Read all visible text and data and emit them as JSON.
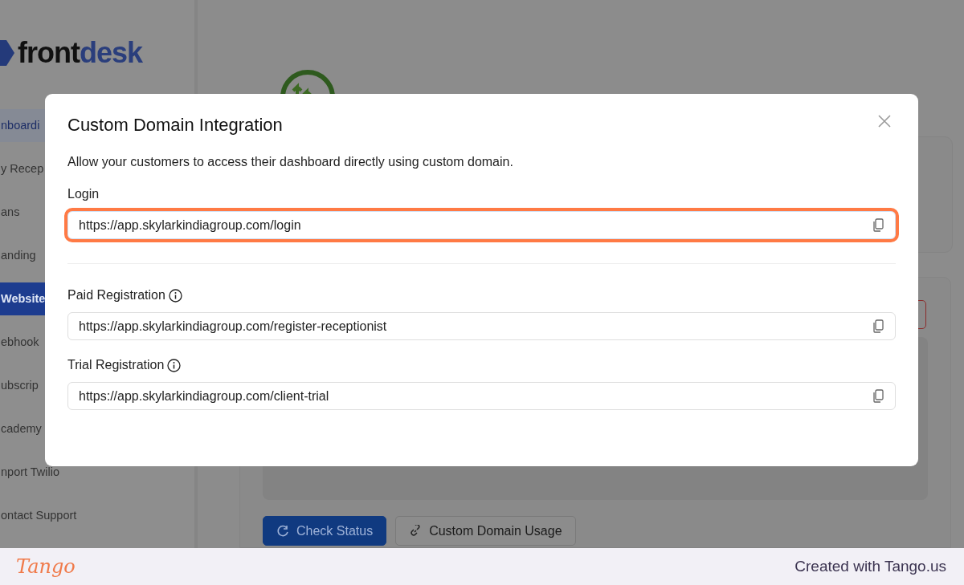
{
  "sidebar": {
    "logo": {
      "first": "front",
      "second": "desk"
    },
    "items": [
      {
        "label": "nboardi",
        "selected": false,
        "highlighted": true
      },
      {
        "label": "y Recep",
        "selected": false,
        "highlighted": false
      },
      {
        "label": "ans",
        "selected": false,
        "highlighted": false
      },
      {
        "label": "anding",
        "selected": false,
        "highlighted": false
      },
      {
        "label": "Website",
        "selected": true,
        "highlighted": false
      },
      {
        "label": "ebhook",
        "selected": false,
        "highlighted": false
      },
      {
        "label": "ubscrip",
        "selected": false,
        "highlighted": false
      },
      {
        "label": "cademy",
        "selected": false,
        "highlighted": false
      },
      {
        "label": "nport Twilio",
        "selected": false,
        "highlighted": false
      },
      {
        "label": "ontact Support",
        "selected": false,
        "highlighted": false
      }
    ]
  },
  "main": {
    "buttons": [
      {
        "label": "Check Status",
        "kind": "primary"
      },
      {
        "label": "Custom Domain Usage",
        "kind": "secondary"
      }
    ]
  },
  "modal": {
    "title": "Custom Domain Integration",
    "description": "Allow your customers to access their dashboard directly using custom domain.",
    "fields": [
      {
        "label": "Login",
        "info": false,
        "value": "https://app.skylarkindiagroup.com/login",
        "highlighted": true,
        "divider_after": true
      },
      {
        "label": "Paid Registration",
        "info": true,
        "value": "https://app.skylarkindiagroup.com/register-receptionist",
        "highlighted": false,
        "divider_after": false
      },
      {
        "label": "Trial Registration",
        "info": true,
        "value": "https://app.skylarkindiagroup.com/client-trial",
        "highlighted": false,
        "divider_after": false
      }
    ]
  },
  "footer": {
    "brand": "Tango",
    "credit": "Created with Tango.us"
  }
}
